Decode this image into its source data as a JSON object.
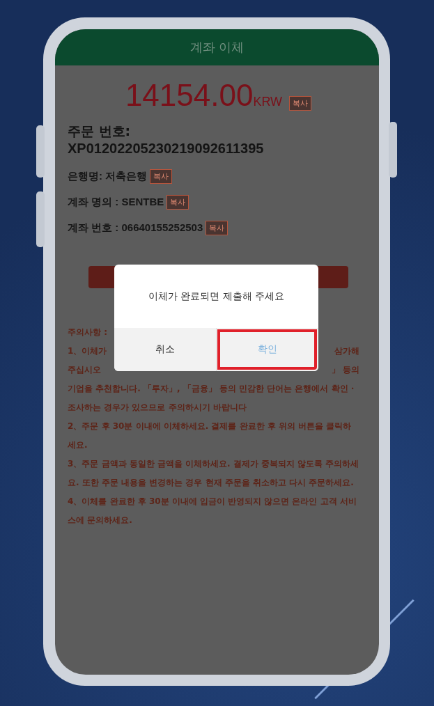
{
  "header": {
    "title": "계좌 이체"
  },
  "amount": {
    "value": "14154.00",
    "currency": "KRW",
    "copy": "복사"
  },
  "order": {
    "label": "주문 번호:",
    "number": "XP01202205230219092611395"
  },
  "fields": [
    {
      "text": "은행명: 저축은행",
      "copy": "복사"
    },
    {
      "text": "계좌 명의 : SENTBE",
      "copy": "복사"
    },
    {
      "text": "계좌 번호 : 06640155252503",
      "copy": "복사"
    }
  ],
  "notes": {
    "title": "주의사항 :",
    "split_lines": [
      {
        "left": "1、이체가",
        "right": "삼가해"
      },
      {
        "left": "주십시오",
        "right": "」 등의"
      }
    ],
    "paragraphs": [
      "기업을 추천합니다. 「투자」, 「금융」 등의 민감한 단어는 은행에서 확인・조사하는 경우가 있으므로 주의하시기 바랍니다",
      "2、주문 후 30분 이내에 이체하세요. 결제를 완료한 후 위의 버튼을 클릭하세요.",
      "3、주문 금액과 동일한 금액을 이체하세요. 결제가 중복되지 않도록 주의하세요. 또한 주문 내용을 변경하는 경우 현재 주문을 취소하고 다시 주문하세요.",
      "4、이체를 완료한 후 30분 이내에 입금이 반영되지 않으면 온라인 고객 서비스에 문의하세요."
    ]
  },
  "dialog": {
    "message": "이체가 완료되면 제출해 주세요",
    "buttons": [
      {
        "label": "취소",
        "highlighted": false
      },
      {
        "label": "확인",
        "highlighted": true
      }
    ]
  }
}
